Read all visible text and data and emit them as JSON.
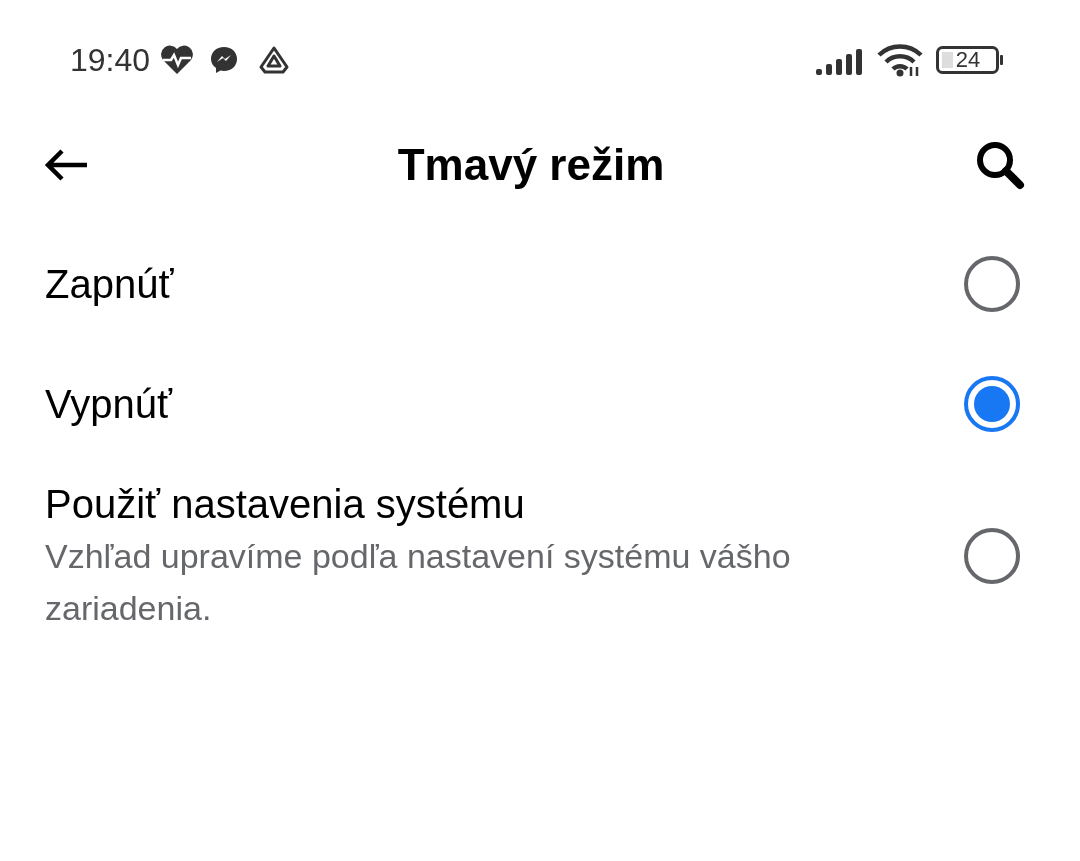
{
  "status_bar": {
    "time": "19:40",
    "battery": "24"
  },
  "header": {
    "title": "Tmavý režim"
  },
  "options": [
    {
      "label": "Zapnúť",
      "selected": false
    },
    {
      "label": "Vypnúť",
      "selected": true
    },
    {
      "label": "Použiť nastavenia systému",
      "description": "Vzhľad upravíme podľa nastavení systému vášho zariadenia.",
      "selected": false
    }
  ]
}
